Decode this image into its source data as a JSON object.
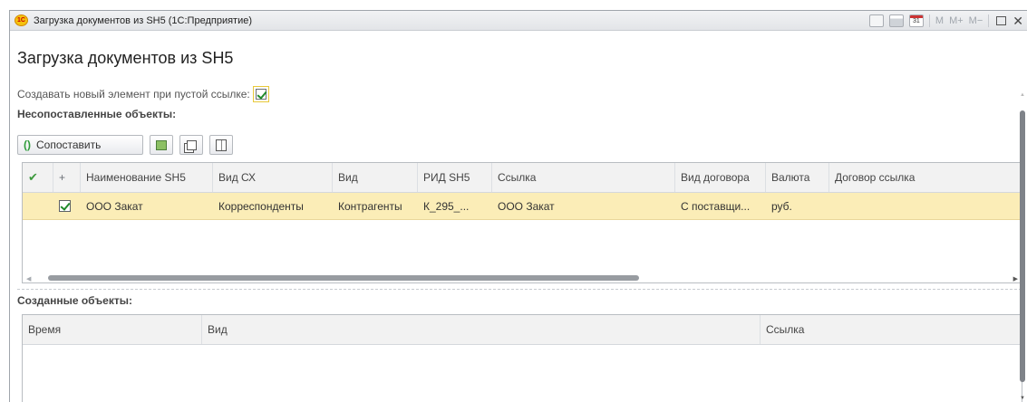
{
  "window": {
    "app_logo": "1С",
    "title": "Загрузка документов из SH5  (1С:Предприятие)",
    "toolbar_m": "M",
    "toolbar_m_plus": "M+",
    "toolbar_m_minus": "M−",
    "close_glyph": "✕",
    "calendar_day": "31"
  },
  "form": {
    "title": "Загрузка документов из SH5",
    "create_new_label": "Создавать новый элемент при пустой ссылке:",
    "create_new_checked": true
  },
  "unmatched": {
    "section_title": "Несопоставленные объекты:",
    "match_button_icon": "()",
    "match_button_label": "Сопоставить",
    "columns": [
      "",
      "+",
      "Наименование SH5",
      "Вид СХ",
      "Вид",
      "РИД SH5",
      "Ссылка",
      "Вид договора",
      "Валюта",
      "Договор ссылка"
    ],
    "header_check_glyph": "✔",
    "rows": [
      {
        "mark": "",
        "checked": true,
        "name": "ООО Закат",
        "vid_sx": "Корреспонденты",
        "vid": "Контрагенты",
        "rid": "К_295_...",
        "link": "ООО Закат",
        "contract_type": "С поставщи...",
        "currency": "руб.",
        "contract_link": ""
      }
    ]
  },
  "created": {
    "section_title": "Созданные объекты:",
    "columns": [
      "Время",
      "Вид",
      "Ссылка"
    ]
  },
  "colors": {
    "selected_row": "#fbedb7",
    "check_green": "#1f8a2a",
    "header_bg": "#f2f2f2"
  }
}
